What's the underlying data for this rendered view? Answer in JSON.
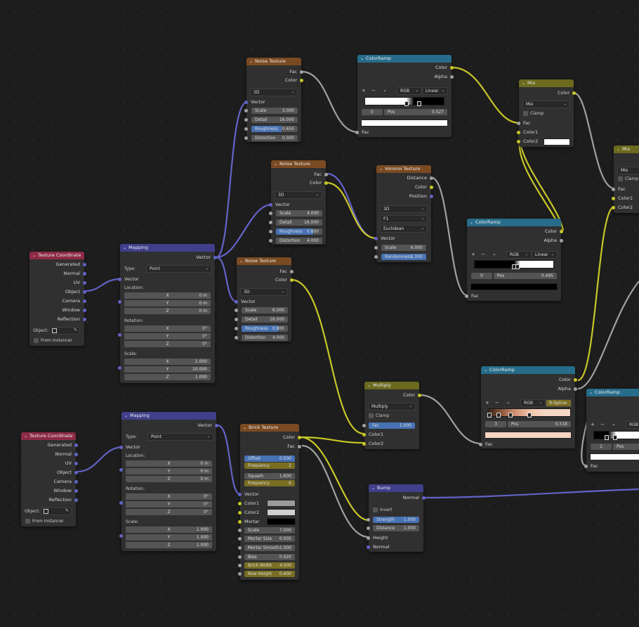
{
  "colors": {
    "tex_header": "#7a4a22",
    "coord_header": "#8c2a46",
    "vector_header": "#3f3f8c",
    "converter_header": "#276c8a",
    "color_header": "#6b6a1e",
    "socket_grey": "#a1a1a1",
    "socket_yellow": "#c7c729",
    "socket_blue": "#6363c7",
    "field_blue": "#4772b3"
  },
  "icons": {
    "collapse": "chevron-down-icon",
    "eyedropper": "eyedropper-icon",
    "object": "object-icon"
  },
  "tc1": {
    "title": "Texture Coordinate",
    "outputs": [
      "Generated",
      "Normal",
      "UV",
      "Object",
      "Camera",
      "Window",
      "Reflection"
    ],
    "object_label": "Object:",
    "from_instancer": "From Instancer"
  },
  "tc2": {
    "title": "Texture Coordinate",
    "outputs": [
      "Generated",
      "Normal",
      "UV",
      "Object",
      "Camera",
      "Window",
      "Reflection"
    ],
    "object_label": "Object:",
    "from_instancer": "From Instancer"
  },
  "map1": {
    "title": "Mapping",
    "output": "Vector",
    "type_label": "Type:",
    "type_value": "Point",
    "vector_label": "Vector",
    "location_label": "Location:",
    "rotation_label": "Rotation:",
    "scale_label": "Scale:",
    "location": {
      "x": "0 m",
      "y": "0 m",
      "z": "0 m"
    },
    "rotation": {
      "x": "0°",
      "y": "0°",
      "z": "0°"
    },
    "scale": {
      "x": "1.000",
      "y": "10.000",
      "z": "1.000"
    },
    "axis": {
      "x": "X",
      "y": "Y",
      "z": "Z"
    }
  },
  "map2": {
    "title": "Mapping",
    "output": "Vector",
    "type_label": "Type:",
    "type_value": "Point",
    "vector_label": "Vector",
    "location_label": "Location:",
    "rotation_label": "Rotation:",
    "scale_label": "Scale:",
    "location": {
      "x": "0 m",
      "y": "0 m",
      "z": "0 m"
    },
    "rotation": {
      "x": "0°",
      "y": "0°",
      "z": "0°"
    },
    "scale": {
      "x": "1.000",
      "y": "1.000",
      "z": "1.000"
    },
    "axis": {
      "x": "X",
      "y": "Y",
      "z": "Z"
    }
  },
  "noise1": {
    "title": "Noise Texture",
    "out_fac": "Fac",
    "out_color": "Color",
    "dim": "3D",
    "vector": "Vector",
    "scale_l": "Scale",
    "scale_v": "3.000",
    "detail_l": "Detail",
    "detail_v": "16.000",
    "rough_l": "Roughness",
    "rough_v": "0.650",
    "rough_frac": 0.65,
    "dist_l": "Distortion",
    "dist_v": "0.000"
  },
  "noise2": {
    "title": "Noise Texture",
    "out_fac": "Fac",
    "out_color": "Color",
    "dim": "3D",
    "vector": "Vector",
    "scale_l": "Scale",
    "scale_v": "4.000",
    "detail_l": "Detail",
    "detail_v": "16.000",
    "rough_l": "Roughness",
    "rough_v": "0.800",
    "rough_frac": 0.8,
    "dist_l": "Distortion",
    "dist_v": "4.000"
  },
  "noise3": {
    "title": "Noise Texture",
    "out_fac": "Fac",
    "out_color": "Color",
    "dim": "3D",
    "vector": "Vector",
    "scale_l": "Scale",
    "scale_v": "6.000",
    "detail_l": "Detail",
    "detail_v": "16.000",
    "rough_l": "Roughness",
    "rough_v": "0.800",
    "rough_frac": 0.8,
    "dist_l": "Distortion",
    "dist_v": "4.000"
  },
  "ramp1": {
    "title": "ColorRamp",
    "out_color": "Color",
    "out_alpha": "Alpha",
    "mode": "RGB",
    "interp": "Linear",
    "index": "0",
    "pos_l": "Pos",
    "pos_v": "0.527",
    "fac": "Fac",
    "plus": "+",
    "minus": "−",
    "menu": "⌄"
  },
  "voronoi": {
    "title": "Voronoi Texture",
    "out_distance": "Distance",
    "out_color": "Color",
    "out_position": "Position",
    "dim": "3D",
    "feature": "F1",
    "metric": "Euclidean",
    "vector": "Vector",
    "scale_l": "Scale",
    "scale_v": "6.000",
    "rand_l": "Randomness",
    "rand_v": "1.000"
  },
  "mix1": {
    "title": "Mix",
    "out_color": "Color",
    "blend": "Mix",
    "clamp": "Clamp",
    "fac": "Fac",
    "color1": "Color1",
    "color2": "Color2"
  },
  "mix2": {
    "title": "Mix",
    "blend": "Mix",
    "clamp": "Clamp",
    "fac": "Fac",
    "color1": "Color1",
    "color2": "Color2"
  },
  "ramp2": {
    "title": "ColorRamp",
    "out_color": "Color",
    "out_alpha": "Alpha",
    "mode": "RGB",
    "interp": "Linear",
    "index": "0",
    "pos_l": "Pos",
    "pos_v": "0.495",
    "fac": "Fac",
    "plus": "+",
    "minus": "−",
    "menu": "⌄"
  },
  "multiply": {
    "title": "Multiply",
    "out_color": "Color",
    "blend": "Multiply",
    "clamp": "Clamp",
    "fac_l": "Fac",
    "fac_v": "1.000",
    "color1": "Color1",
    "color2": "Color2"
  },
  "ramp3": {
    "title": "ColorRamp",
    "out_color": "Color",
    "out_alpha": "Alpha",
    "mode": "RGB",
    "interp": "B-Spline",
    "index": "3",
    "pos_l": "Pos",
    "pos_v": "0.518",
    "fac": "Fac",
    "plus": "+",
    "minus": "−",
    "menu": "⌄"
  },
  "ramp4": {
    "title": "ColorRamp",
    "mode": "RGB",
    "index": "1",
    "pos_l": "Pos",
    "fac": "Fac",
    "plus": "+",
    "minus": "−",
    "menu": "⌄"
  },
  "brick": {
    "title": "Brick Texture",
    "out_color": "Color",
    "out_fac": "Fac",
    "offset_l": "Offset",
    "offset_v": "0.500",
    "freq1_l": "Frequency",
    "freq1_v": "2",
    "squash_l": "Squash",
    "squash_v": "1.600",
    "freq2_l": "Frequency",
    "freq2_v": "6",
    "vector": "Vector",
    "color1": "Color1",
    "color2": "Color2",
    "mortar": "Mortar",
    "scale_l": "Scale",
    "scale_v": "7.000",
    "msize_l": "Mortar Size",
    "msize_v": "0.005",
    "msmooth_l": "Mortar Smooth",
    "msmooth_v": "1.000",
    "bias_l": "Bias",
    "bias_v": "0.020",
    "bw_l": "Brick Width",
    "bw_v": "4.000",
    "rh_l": "Row Height",
    "rh_v": "0.600"
  },
  "bump": {
    "title": "Bump",
    "out_normal": "Normal",
    "invert": "Invert",
    "strength_l": "Strength",
    "strength_v": "1.000",
    "distance_l": "Distance",
    "distance_v": "1.000",
    "height": "Height",
    "normal": "Normal"
  }
}
